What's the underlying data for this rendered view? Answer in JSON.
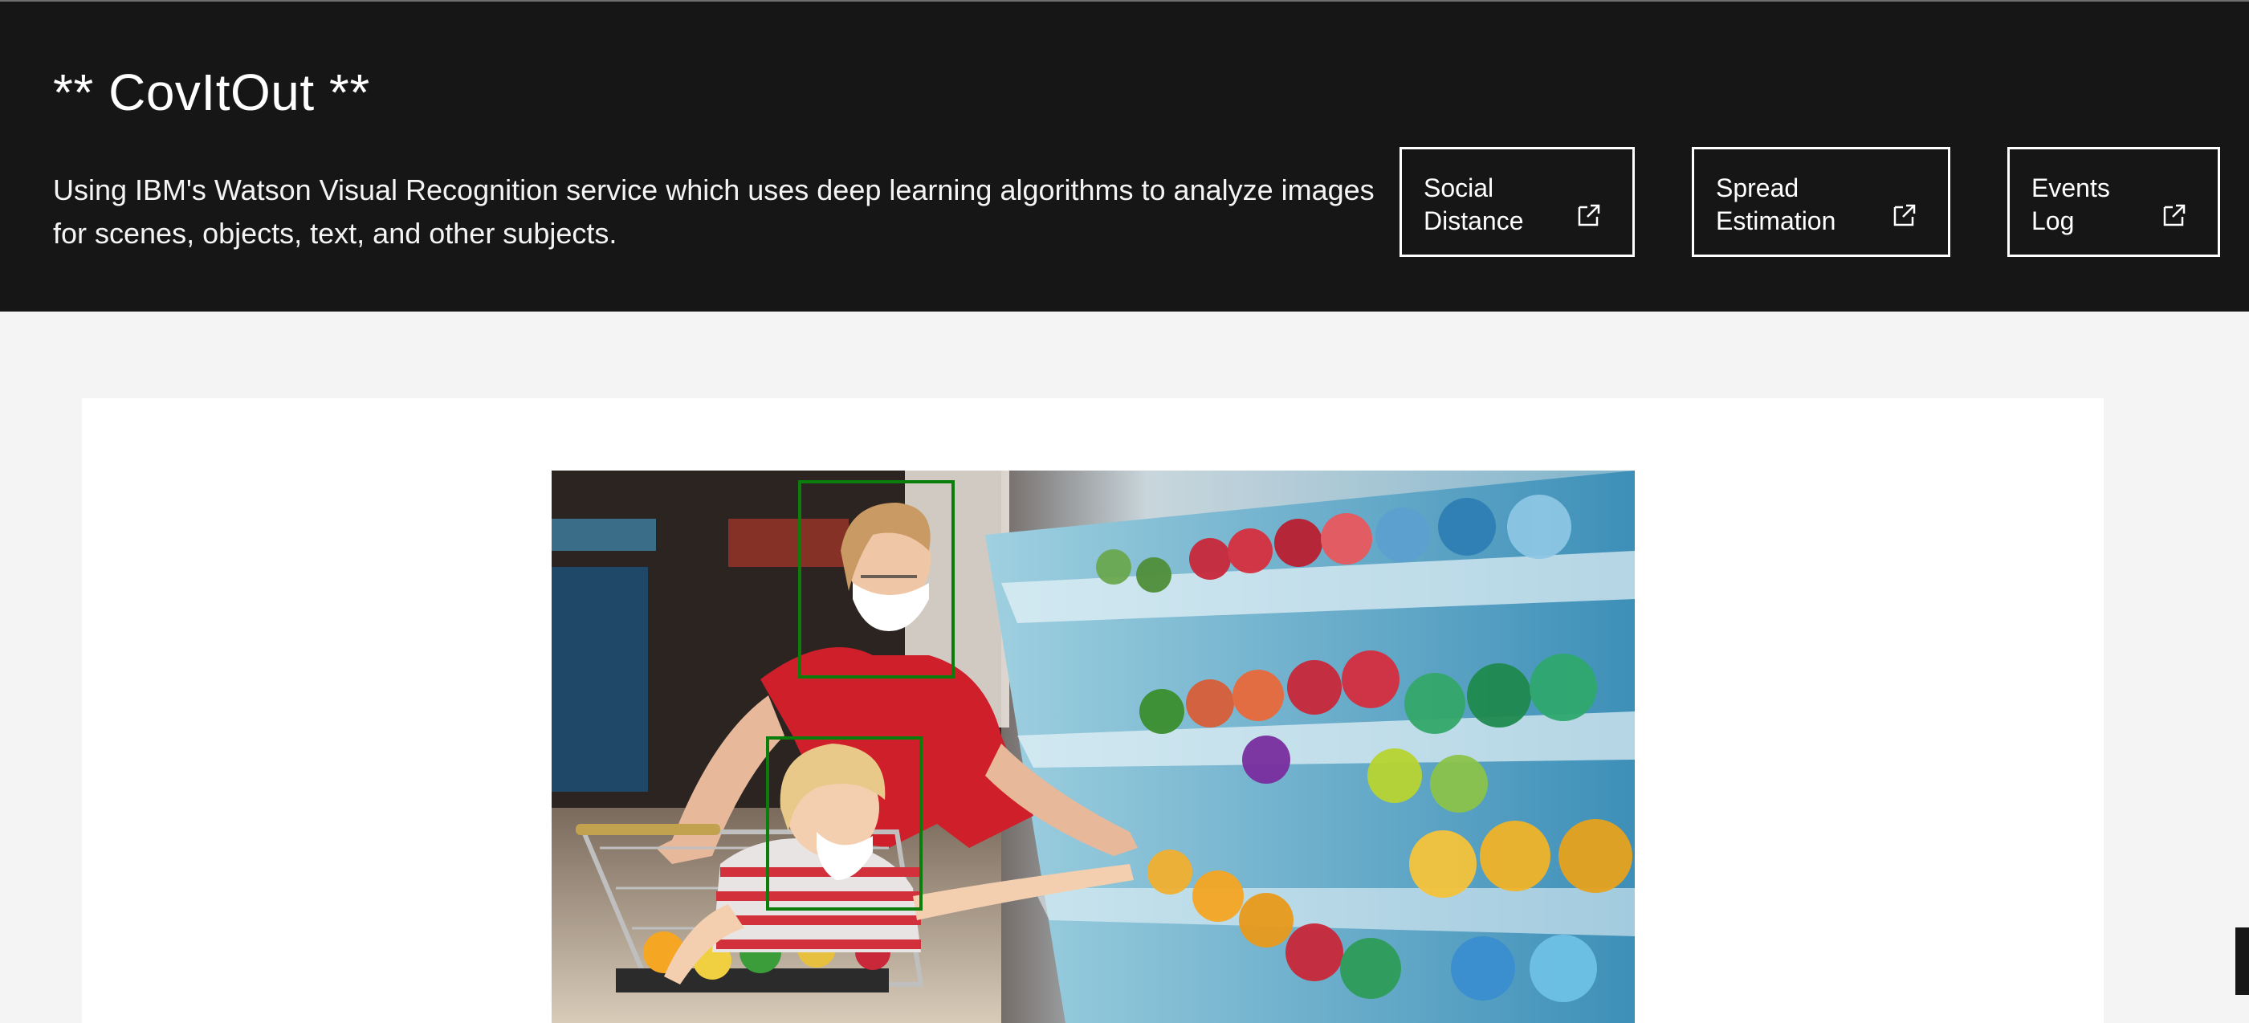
{
  "header": {
    "title": "** CovItOut **",
    "description": "Using IBM's Watson Visual Recognition service which uses deep learning algorithms to analyze images for scenes, objects, text, and other subjects.",
    "links": [
      {
        "label": "Social\nDistance",
        "icon": "external-link-icon"
      },
      {
        "label": "Spread\nEstimation",
        "icon": "external-link-icon"
      },
      {
        "label": "Events\nLog",
        "icon": "external-link-icon"
      }
    ]
  },
  "main": {
    "image": {
      "subject": "woman and child wearing face masks shopping at produce aisle",
      "detections": [
        {
          "label": "face",
          "color": "#0a7d0a"
        },
        {
          "label": "face",
          "color": "#0a7d0a"
        }
      ]
    }
  },
  "colors": {
    "header_bg": "#161616",
    "page_bg": "#f4f4f4",
    "card_bg": "#ffffff",
    "detection_box": "#0a7d0a"
  }
}
